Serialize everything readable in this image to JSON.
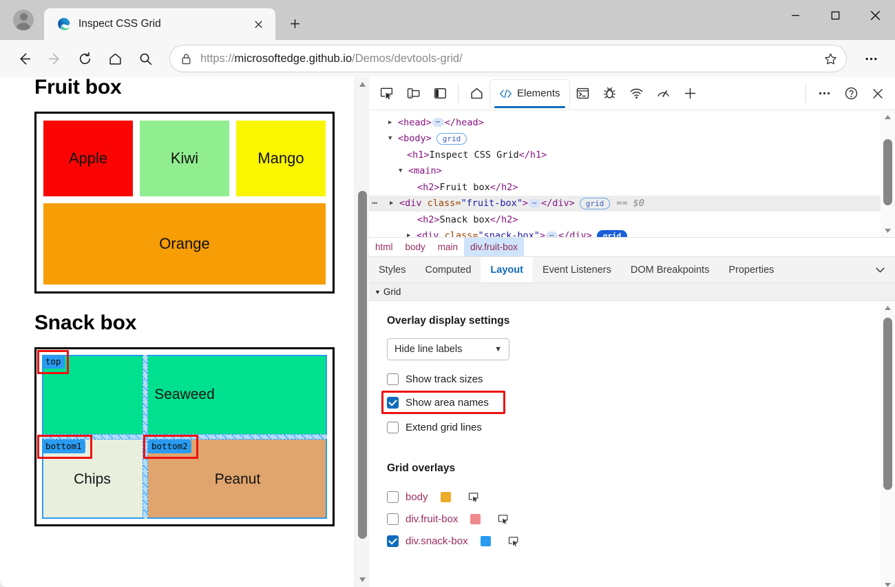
{
  "window": {
    "tab_title": "Inspect CSS Grid",
    "new_tab_label": "+",
    "minimize_label": "—",
    "maximize_label": "□",
    "close_label": "×"
  },
  "toolbar": {
    "url_scheme": "https://",
    "url_host": "microsoftedge.github.io",
    "url_path": "/Demos/devtools-grid/",
    "url_full": "https://microsoftedge.github.io/Demos/devtools-grid/",
    "back_icon": "back-arrow-icon",
    "forward_icon": "forward-arrow-icon",
    "refresh_icon": "refresh-icon",
    "home_icon": "home-icon",
    "search_icon": "search-icon",
    "lock_icon": "lock-icon",
    "favorite_icon": "star-icon",
    "settings_icon": "ellipsis-icon"
  },
  "page": {
    "h1": "Inspect CSS Grid",
    "fruit_heading": "Fruit box",
    "snack_heading": "Snack box",
    "fruit_cells": [
      {
        "label": "Apple",
        "color": "#fb0404"
      },
      {
        "label": "Kiwi",
        "color": "#90ee90"
      },
      {
        "label": "Mango",
        "color": "#faf500"
      },
      {
        "label": "Orange",
        "color": "#f79d05"
      }
    ],
    "snack_cells": [
      {
        "label": "Seaweed",
        "color": "#00e08f",
        "area": "top"
      },
      {
        "label": "Chips",
        "color": "#e9efdd",
        "area": "bottom1"
      },
      {
        "label": "Peanut",
        "color": "#e0a56e",
        "area": "bottom2"
      }
    ],
    "area_badges": [
      "top",
      "bottom1",
      "bottom2"
    ]
  },
  "devtools": {
    "toolbar_icons": [
      "inspect-element-icon",
      "device-emulation-icon",
      "dock-side-icon",
      "home-icon",
      "console-icon",
      "sources-bug-icon",
      "network-wifi-icon",
      "performance-gauge-icon",
      "add-tool-icon",
      "more-tools-icon",
      "help-icon",
      "close-devtools-icon"
    ],
    "active_tab": "Elements",
    "elements_tab_label": "Elements",
    "dom_rows": [
      {
        "indent": 1,
        "tri": "▶",
        "markup": "<head>…</head>",
        "badge": null,
        "selected": false
      },
      {
        "indent": 1,
        "tri": "▼",
        "markup": "<body>",
        "badge": "grid",
        "badge_on": false,
        "selected": false
      },
      {
        "indent": 2,
        "tri": "",
        "markup": "<h1>Inspect CSS Grid</h1>",
        "badge": null,
        "selected": false
      },
      {
        "indent": 1.6,
        "tri": "▼",
        "markup": "<main>",
        "badge": null,
        "selected": false
      },
      {
        "indent": 2.5,
        "tri": "",
        "markup": "<h2>Fruit box</h2>",
        "badge": null,
        "selected": false
      },
      {
        "indent": 2,
        "tri": "▶",
        "markup": "<div class=\"fruit-box\">…</div>",
        "badge": "grid",
        "badge_on": false,
        "selected": true,
        "trailing": "== $0"
      },
      {
        "indent": 2.5,
        "tri": "",
        "markup": "<h2>Snack box</h2>",
        "badge": null,
        "selected": false
      },
      {
        "indent": 2,
        "tri": "▶",
        "markup": "<div class=\"snack-box\">…</div>",
        "badge": "grid",
        "badge_on": true,
        "selected": false
      }
    ],
    "dom_text": {
      "head_tag": "head",
      "body_tag": "body",
      "h1_tag": "h1",
      "h1_text": "Inspect CSS Grid",
      "main_tag": "main",
      "h2_tag": "h2",
      "h2_fruit_text": "Fruit box",
      "h2_snack_text": "Snack box",
      "div_tag": "div",
      "class_attr": "class",
      "fruit_class": "\"fruit-box\"",
      "snack_class": "\"snack-box\"",
      "selected_marker": "== $0",
      "grid_badge": "grid",
      "row_menu_dots": "⋯"
    },
    "breadcrumb": [
      {
        "label": "html",
        "active": false
      },
      {
        "label": "body",
        "active": false
      },
      {
        "label": "main",
        "active": false
      },
      {
        "label": "div.fruit-box",
        "active": true
      }
    ],
    "panel_tabs": [
      {
        "label": "Styles",
        "active": false
      },
      {
        "label": "Computed",
        "active": false
      },
      {
        "label": "Layout",
        "active": true
      },
      {
        "label": "Event Listeners",
        "active": false
      },
      {
        "label": "DOM Breakpoints",
        "active": false
      },
      {
        "label": "Properties",
        "active": false
      }
    ],
    "grid_section_label": "Grid",
    "overlay_settings": {
      "title": "Overlay display settings",
      "line_labels_select": "Hide line labels",
      "checkboxes": [
        {
          "label": "Show track sizes",
          "checked": false,
          "highlighted": false
        },
        {
          "label": "Show area names",
          "checked": true,
          "highlighted": true
        },
        {
          "label": "Extend grid lines",
          "checked": false,
          "highlighted": false
        }
      ]
    },
    "grid_overlays": {
      "title": "Grid overlays",
      "items": [
        {
          "name": "body",
          "checked": false,
          "color": "#eeac2b"
        },
        {
          "name": "div.fruit-box",
          "checked": false,
          "color": "#ef8a8a"
        },
        {
          "name": "div.snack-box",
          "checked": true,
          "color": "#2a9bf0"
        }
      ]
    }
  },
  "colors": {
    "accent": "#0f6cbd",
    "highlight_red": "#ee1111",
    "grid_blue": "#2a9bf0",
    "tag_purple": "#881280",
    "attr_brown": "#994500",
    "value_blue": "#1a1aa6",
    "breadcrumb_pink": "#9b2c5e"
  }
}
